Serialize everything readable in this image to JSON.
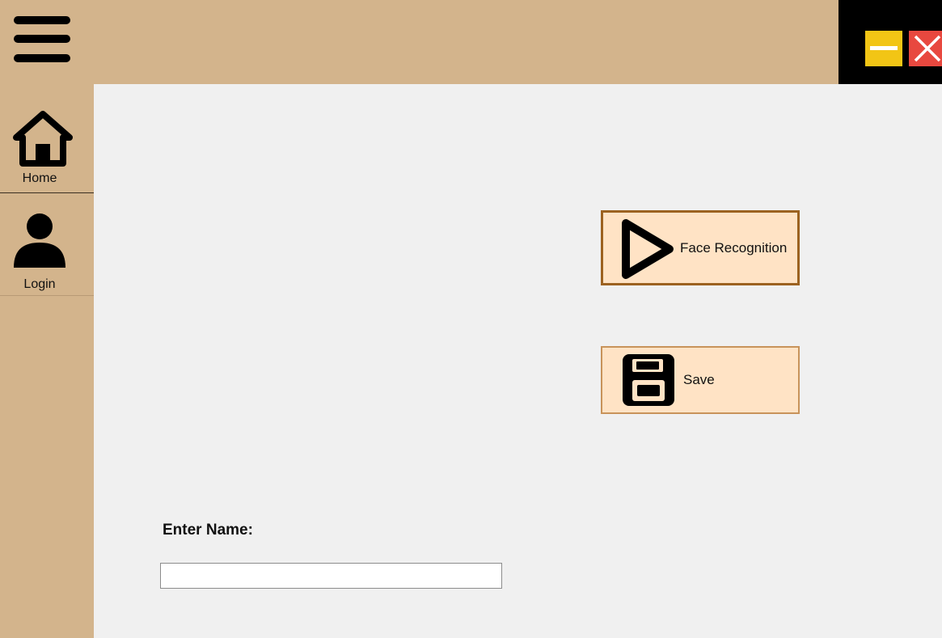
{
  "sidebar": {
    "items": [
      {
        "id": "home",
        "label": "Home",
        "icon": "home-icon"
      },
      {
        "id": "login",
        "label": "Login",
        "icon": "user-icon"
      }
    ]
  },
  "header": {
    "menu_icon": "hamburger-menu-icon",
    "window_controls": {
      "minimize_icon": "minimize-icon",
      "close_icon": "close-icon"
    }
  },
  "main": {
    "face_recognition_button": {
      "label": "Face Recognition",
      "icon": "play-icon"
    },
    "save_button": {
      "label": "Save",
      "icon": "floppy-disk-icon"
    },
    "name_field": {
      "label": "Enter Name:",
      "value": "",
      "placeholder": ""
    }
  },
  "colors": {
    "sidebar_background": "#d3b48c",
    "content_background": "#f0f0f0",
    "button_background": "#ffe3c5",
    "button_border": "#9c6220",
    "minimize_button": "#f2c515",
    "close_button": "#e8483f",
    "window_controls_background": "#000000"
  }
}
